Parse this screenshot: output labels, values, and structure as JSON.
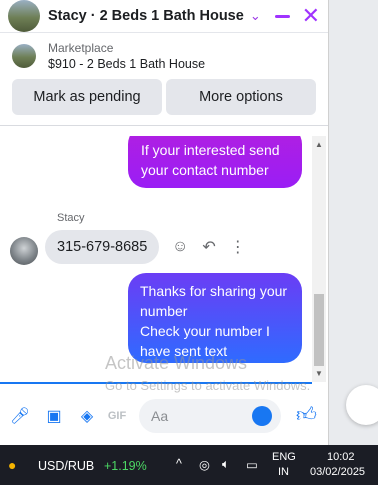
{
  "header": {
    "title": "Stacy · 2 Beds 1 Bath House",
    "accent": "#a033ff"
  },
  "marketplace": {
    "label": "Marketplace",
    "listing": "$910 - 2 Beds 1 Bath House"
  },
  "actions": {
    "pending": "Mark as pending",
    "more": "More options"
  },
  "messages": {
    "out1": "If your interested send your contact number",
    "sender": "Stacy",
    "in1": "315-679-8685",
    "out2_line1": "Thanks for sharing your number",
    "out2_line2": "Check your number I have sent text"
  },
  "composer": {
    "placeholder": "Aa"
  },
  "watermark": {
    "title": "Activate Windows",
    "subtitle": "Go to Settings to activate Windows."
  },
  "taskbar": {
    "ticker": "USD/RUB",
    "change": "+1.19%",
    "lang1": "ENG",
    "lang2": "IN",
    "time": "10:02",
    "date": "03/02/2025"
  }
}
